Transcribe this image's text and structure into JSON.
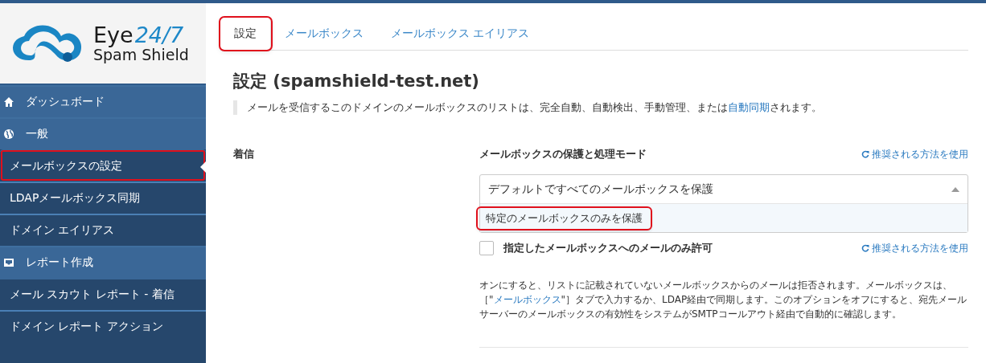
{
  "logo": {
    "word": "Eye",
    "accent": "24/7",
    "subtitle": "Spam Shield"
  },
  "sidebar": {
    "items": [
      {
        "kind": "section",
        "label": "ダッシュボード",
        "selected": false,
        "highlighted": false
      },
      {
        "kind": "section",
        "label": "一般",
        "selected": false,
        "highlighted": false
      },
      {
        "kind": "item",
        "label": "メールボックスの設定",
        "selected": true,
        "highlighted": true
      },
      {
        "kind": "item",
        "label": "LDAPメールボックス同期",
        "selected": false,
        "highlighted": false
      },
      {
        "kind": "item",
        "label": "ドメイン エイリアス",
        "selected": false,
        "highlighted": false
      },
      {
        "kind": "section",
        "label": "レポート作成",
        "selected": false,
        "highlighted": false
      },
      {
        "kind": "item",
        "label": "メール スカウト レポート - 着信",
        "selected": false,
        "highlighted": false
      },
      {
        "kind": "item",
        "label": "ドメイン レポート アクション",
        "selected": false,
        "highlighted": false
      }
    ]
  },
  "tabs": [
    {
      "label": "設定",
      "selected": true,
      "highlighted": true
    },
    {
      "label": "メールボックス",
      "selected": false,
      "highlighted": false
    },
    {
      "label": "メールボックス エイリアス",
      "selected": false,
      "highlighted": false
    }
  ],
  "title": "設定 (spamshield-test.net)",
  "description": {
    "text": "メールを受信するこのドメインのメールボックスのリストは、完全自動、自動検出、手動管理、または",
    "link": "自動同期",
    "text_after": "されます。"
  },
  "section_label": "着信",
  "mode": {
    "label": "メールボックスの保護と処理モード",
    "reset_link": "推奨される方法を使用",
    "value": "デフォルトですべてのメールボックスを保護",
    "expanded": true,
    "options": [
      {
        "label": "特定のメールボックスのみを保護",
        "highlighted": true
      }
    ]
  },
  "restrict": {
    "label": "指定したメールボックスへのメールのみ許可",
    "checked": false,
    "reset_link": "推奨される方法を使用",
    "help_before": "オンにすると、リストに記載されていないメールボックスからのメールは拒否されます。メールボックスは、［\"",
    "help_link": "メールボックス",
    "help_after": "\"］タブで入力するか、LDAP経由で同期します。このオプションをオフにすると、宛先メールサーバーのメールボックスの有効性をシステムがSMTPコールアウト経由で自動的に確認します。"
  }
}
